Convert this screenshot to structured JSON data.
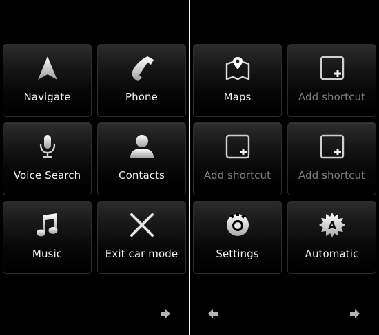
{
  "left_page": {
    "tiles": [
      {
        "label": "Navigate",
        "icon": "navigate-arrow-icon"
      },
      {
        "label": "Phone",
        "icon": "phone-handset-icon"
      },
      {
        "label": "Voice Search",
        "icon": "microphone-icon"
      },
      {
        "label": "Contacts",
        "icon": "contact-person-icon"
      },
      {
        "label": "Music",
        "icon": "music-note-icon"
      },
      {
        "label": "Exit car mode",
        "icon": "close-x-icon"
      }
    ],
    "next_icon": "arrow-right-icon"
  },
  "right_page": {
    "tiles": [
      {
        "label": "Maps",
        "icon": "map-pin-icon"
      },
      {
        "label": "Add shortcut",
        "icon": "add-shortcut-icon"
      },
      {
        "label": "Add shortcut",
        "icon": "add-shortcut-icon"
      },
      {
        "label": "Add shortcut",
        "icon": "add-shortcut-icon"
      },
      {
        "label": "Settings",
        "icon": "settings-gear-icon"
      },
      {
        "label": "Automatic",
        "icon": "automatic-badge-icon"
      }
    ],
    "prev_icon": "arrow-left-icon",
    "next_icon": "arrow-right-icon",
    "automatic_badge_letter": "A"
  },
  "colors": {
    "background": "#000000",
    "tile_label": "#f2f2f2",
    "placeholder_label": "#7d7d7d",
    "icon": "#dcdcdc",
    "divider": "#f2f2f2"
  }
}
